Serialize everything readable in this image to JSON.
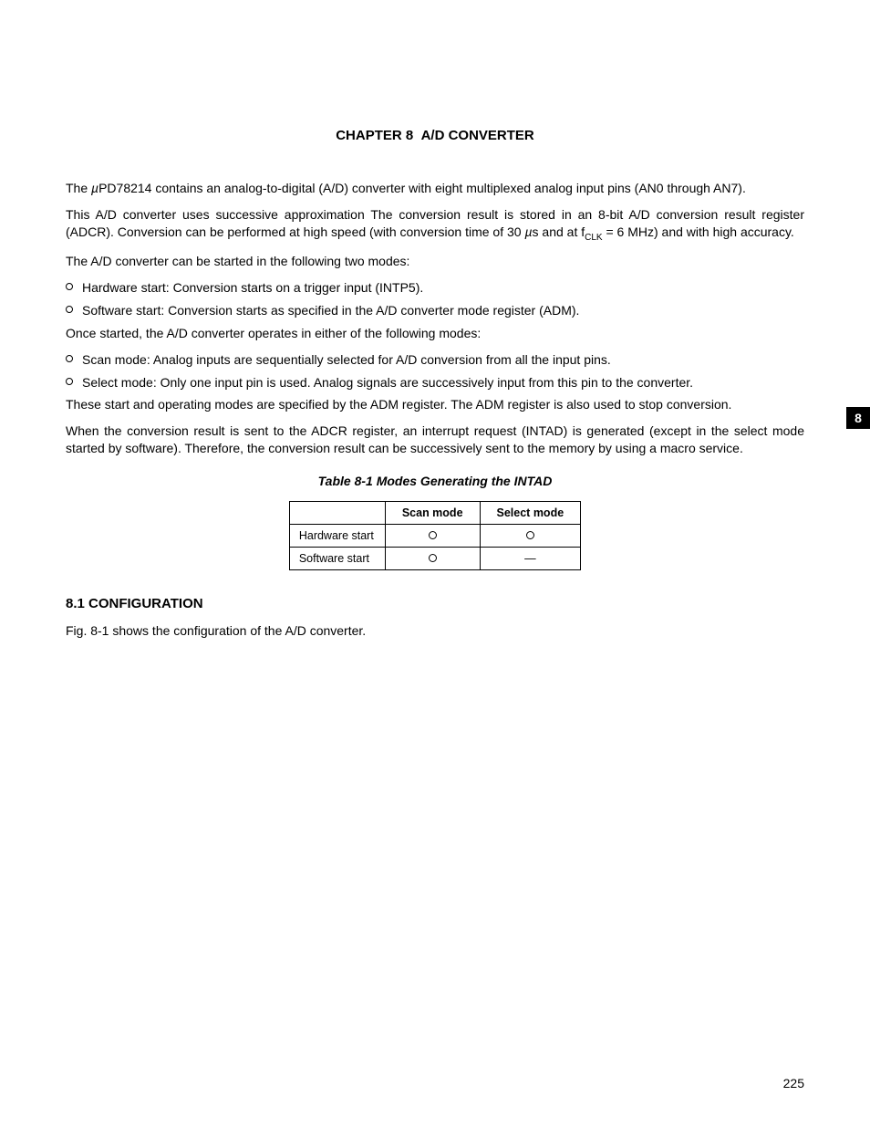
{
  "chapter": {
    "title_pre": "CHAPTER 8",
    "title_post": "A/D CONVERTER"
  },
  "paragraphs": {
    "p1": "PD78214 contains an analog-to-digital (A/D) converter with eight multiplexed analog input pins (AN0 through AN7).",
    "p2a": "This A/D converter uses successive approximation  The conversion result is stored in an 8-bit A/D conversion result register (ADCR).  Conversion can be performed at high speed (with conversion time of 30 ",
    "p2b": "s and at f",
    "p2c": " = 6 MHz) and with high accuracy.",
    "p3": "The A/D converter can be started in the following two modes:",
    "li1": "Hardware start:  Conversion starts on a trigger input (INTP5).",
    "li2": "Software start:  Conversion starts as specified in the A/D converter mode register (ADM).",
    "p4": "Once started, the A/D converter operates in either of the following modes:",
    "li3": "Scan mode:  Analog inputs are sequentially selected for A/D conversion from all the input pins.",
    "li4": "Select mode:  Only one input pin is used.  Analog signals are successively input from this pin to the converter.",
    "p5": "These start and operating modes are specified by the ADM register.  The ADM register is also used to stop conversion.",
    "p6": "When the conversion result is sent to the ADCR register, an interrupt request (INTAD) is generated (except in the select mode started by software).  Therefore, the conversion result can be successively sent to the memory by using a macro service."
  },
  "table": {
    "caption": "Table 8-1  Modes Generating the INTAD",
    "header_scan": "Scan mode",
    "header_select": "Select mode",
    "row1_label": "Hardware start",
    "row2_label": "Software start",
    "dash": "—"
  },
  "section": {
    "heading": "8.1  CONFIGURATION",
    "body": "Fig. 8-1 shows the configuration of the A/D converter."
  },
  "side_tab": "8",
  "page_number": "225",
  "symbols": {
    "mu": "µ",
    "clk": "CLK"
  }
}
